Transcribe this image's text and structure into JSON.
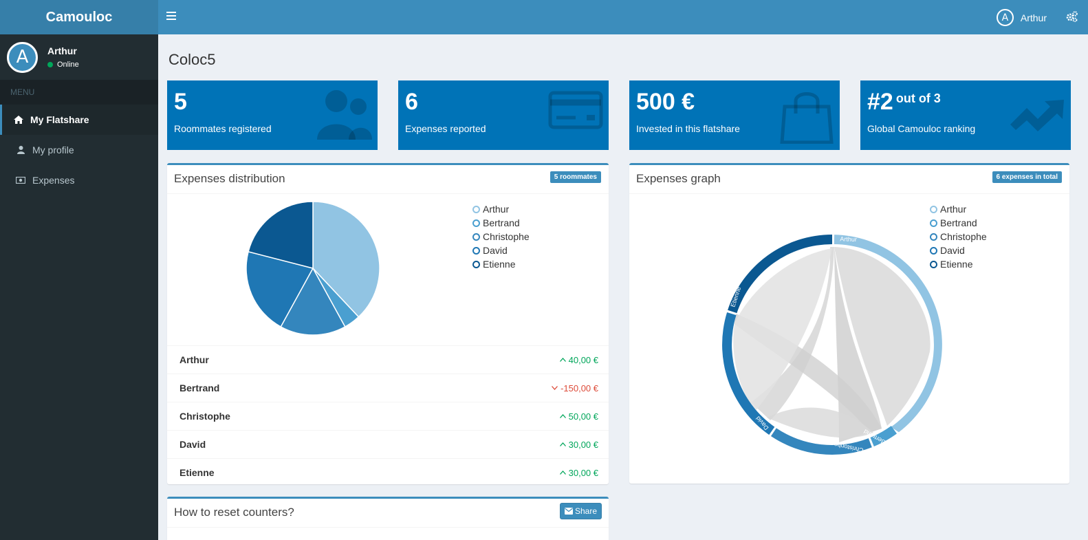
{
  "app": {
    "brand": "Camouloc"
  },
  "sidebar": {
    "user": {
      "initial": "A",
      "name": "Arthur",
      "status": "Online"
    },
    "menu_header": "MENU",
    "items": [
      {
        "label": "My Flatshare",
        "icon": "home-icon",
        "active": true
      },
      {
        "label": "My profile",
        "icon": "user-icon",
        "active": false
      },
      {
        "label": "Expenses",
        "icon": "money-icon",
        "active": false
      }
    ]
  },
  "topbar": {
    "user_initial": "A",
    "user_name": "Arthur",
    "settings_icon": "gears-icon"
  },
  "page": {
    "title": "Coloc5"
  },
  "stats": [
    {
      "value": "5",
      "suffix": "",
      "label": "Roommates registered",
      "icon": "users-icon"
    },
    {
      "value": "6",
      "suffix": "",
      "label": "Expenses reported",
      "icon": "credit-card-icon"
    },
    {
      "value": "500 €",
      "suffix": "",
      "label": "Invested in this flatshare",
      "icon": "shopping-bag-icon"
    },
    {
      "value": "#2",
      "suffix": "out of 3",
      "label": "Global Camouloc ranking",
      "icon": "trend-up-icon"
    }
  ],
  "distribution": {
    "title": "Expenses distribution",
    "badge": "5 roommates",
    "legend": [
      "Arthur",
      "Bertrand",
      "Christophe",
      "David",
      "Etienne"
    ],
    "rows": [
      {
        "name": "Arthur",
        "amount": "40,00 €",
        "trend": "up"
      },
      {
        "name": "Bertrand",
        "amount": "-150,00 €",
        "trend": "down"
      },
      {
        "name": "Christophe",
        "amount": "50,00 €",
        "trend": "up"
      },
      {
        "name": "David",
        "amount": "30,00 €",
        "trend": "up"
      },
      {
        "name": "Etienne",
        "amount": "30,00 €",
        "trend": "up"
      }
    ]
  },
  "graph": {
    "title": "Expenses graph",
    "badge": "6 expenses in total",
    "legend": [
      "Arthur",
      "Bertrand",
      "Christophe",
      "David",
      "Etienne"
    ],
    "arc_labels": [
      "Arthur",
      "Bertrand",
      "Christophe",
      "David",
      "Etienne"
    ]
  },
  "reset": {
    "title": "How to reset counters?",
    "share_label": "Share"
  },
  "colors": {
    "series": [
      "#91c4e3",
      "#4a9fd0",
      "#3486bd",
      "#1f77b4",
      "#0b5891"
    ],
    "stat_box": "#0073b7",
    "accent": "#3c8dbc"
  },
  "chart_data": [
    {
      "type": "pie",
      "categories": [
        "Arthur",
        "Bertrand",
        "Christophe",
        "David",
        "Etienne"
      ],
      "values": [
        38,
        4,
        16,
        21,
        21
      ]
    }
  ]
}
